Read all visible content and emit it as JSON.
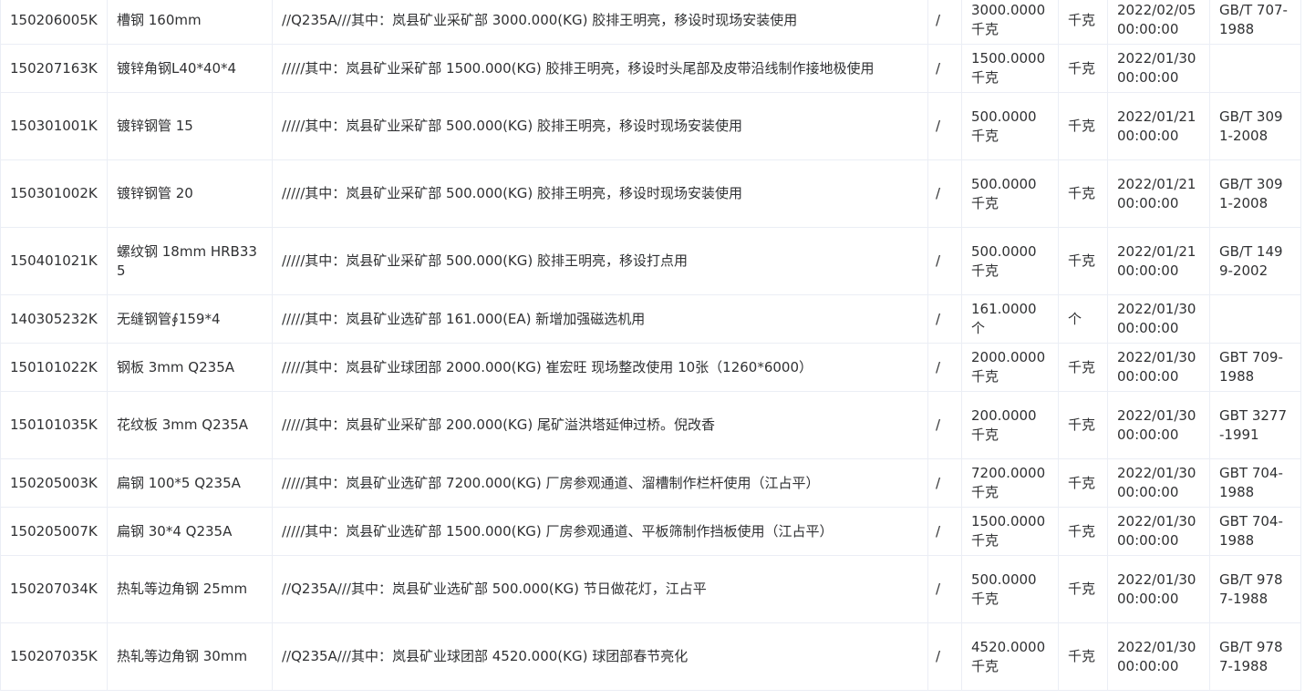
{
  "table": {
    "rows": [
      {
        "code": "150206005K",
        "name": "槽钢 160mm",
        "desc": "//Q235A///其中：岚县矿业采矿部 3000.000(KG) 胶排王明亮，移设时现场安装使用",
        "flag": "/",
        "qty": "3000.0000千克",
        "unit": "千克",
        "date": "2022/02/05 00:00:00",
        "std": "GB/T 707-1988"
      },
      {
        "code": "150207163K",
        "name": "镀锌角钢L40*40*4",
        "desc": "/////其中：岚县矿业采矿部 1500.000(KG) 胶排王明亮，移设时头尾部及皮带沿线制作接地极使用",
        "flag": "/",
        "qty": "1500.0000千克",
        "unit": "千克",
        "date": "2022/01/30 00:00:00",
        "std": ""
      },
      {
        "code": "150301001K",
        "name": "镀锌钢管 15",
        "desc": "/////其中：岚县矿业采矿部 500.000(KG) 胶排王明亮，移设时现场安装使用",
        "flag": "/",
        "qty": "500.0000千克",
        "unit": "千克",
        "date": "2022/01/21 00:00:00",
        "std": "GB/T 3091-2008"
      },
      {
        "code": "150301002K",
        "name": "镀锌钢管 20",
        "desc": "/////其中：岚县矿业采矿部 500.000(KG) 胶排王明亮，移设时现场安装使用",
        "flag": "/",
        "qty": "500.0000千克",
        "unit": "千克",
        "date": "2022/01/21 00:00:00",
        "std": "GB/T 3091-2008"
      },
      {
        "code": "150401021K",
        "name": "螺纹钢 18mm HRB335",
        "desc": "/////其中：岚县矿业采矿部 500.000(KG) 胶排王明亮，移设打点用",
        "flag": "/",
        "qty": "500.0000千克",
        "unit": "千克",
        "date": "2022/01/21 00:00:00",
        "std": "GB/T 1499-2002"
      },
      {
        "code": "140305232K",
        "name": "无缝钢管∮159*4",
        "desc": "/////其中：岚县矿业选矿部 161.000(EA) 新增加强磁选机用",
        "flag": "/",
        "qty": "161.0000个",
        "unit": "个",
        "date": "2022/01/30 00:00:00",
        "std": ""
      },
      {
        "code": "150101022K",
        "name": "钢板 3mm Q235A",
        "desc": "/////其中：岚县矿业球团部 2000.000(KG) 崔宏旺 现场整改使用 10张（1260*6000）",
        "flag": "/",
        "qty": "2000.0000千克",
        "unit": "千克",
        "date": "2022/01/30 00:00:00",
        "std": "GBT 709-1988"
      },
      {
        "code": "150101035K",
        "name": "花纹板 3mm Q235A",
        "desc": "/////其中：岚县矿业采矿部 200.000(KG) 尾矿溢洪塔延伸过桥。倪改香",
        "flag": "/",
        "qty": "200.0000千克",
        "unit": "千克",
        "date": "2022/01/30 00:00:00",
        "std": "GBT 3277-1991"
      },
      {
        "code": "150205003K",
        "name": "扁钢 100*5 Q235A",
        "desc": "/////其中：岚县矿业选矿部 7200.000(KG) 厂房参观通道、溜槽制作栏杆使用（江占平）",
        "flag": "/",
        "qty": "7200.0000千克",
        "unit": "千克",
        "date": "2022/01/30 00:00:00",
        "std": "GBT 704-1988"
      },
      {
        "code": "150205007K",
        "name": "扁钢 30*4 Q235A",
        "desc": "/////其中：岚县矿业选矿部 1500.000(KG) 厂房参观通道、平板筛制作挡板使用（江占平）",
        "flag": "/",
        "qty": "1500.0000千克",
        "unit": "千克",
        "date": "2022/01/30 00:00:00",
        "std": "GBT 704-1988"
      },
      {
        "code": "150207034K",
        "name": "热轧等边角钢 25mm",
        "desc": "//Q235A///其中：岚县矿业选矿部 500.000(KG) 节日做花灯，江占平",
        "flag": "/",
        "qty": "500.0000千克",
        "unit": "千克",
        "date": "2022/01/30 00:00:00",
        "std": "GB/T 9787-1988"
      },
      {
        "code": "150207035K",
        "name": "热轧等边角钢 30mm",
        "desc": "//Q235A///其中：岚县矿业球团部 4520.000(KG) 球团部春节亮化",
        "flag": "/",
        "qty": "4520.0000千克",
        "unit": "千克",
        "date": "2022/01/30 00:00:00",
        "std": "GB/T 9787-1988"
      }
    ]
  }
}
